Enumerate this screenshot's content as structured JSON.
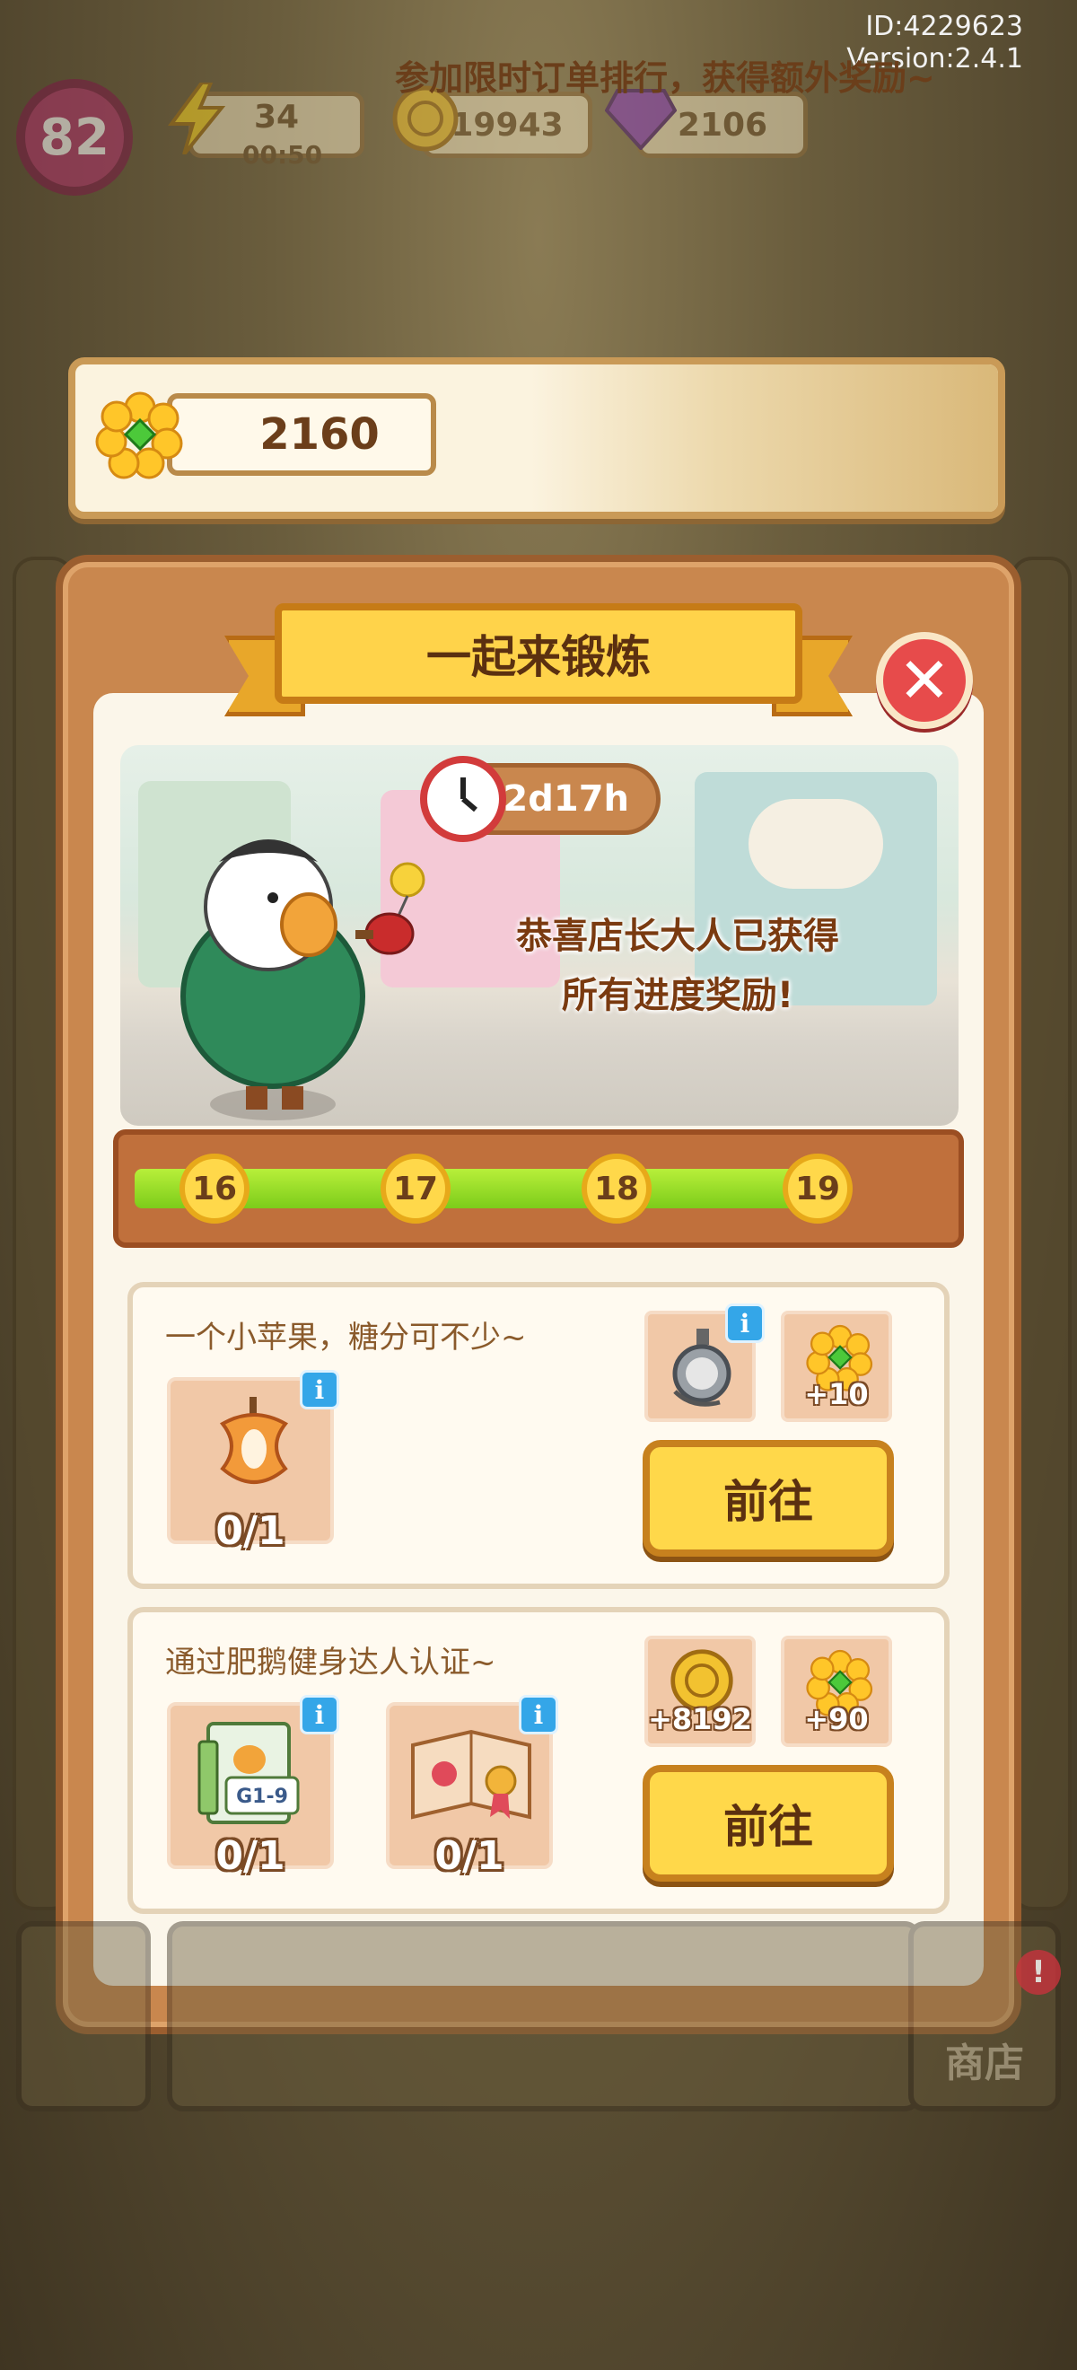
{
  "meta": {
    "id_text": "ID:4229623",
    "version_text": "Version:2.4.1"
  },
  "hud": {
    "level": "82",
    "energy": "34",
    "energy_timer": "00:50",
    "coins": "19943",
    "gems": "2106"
  },
  "event_banner": {
    "flower_count": "2160",
    "text": "参加限时订单排行，获得额外奖励~"
  },
  "panel": {
    "title": "一起来锻炼",
    "timer": "2d17h",
    "congrats_line1": "恭喜店长大人已获得",
    "congrats_line2": "所有进度奖励!",
    "progress_fraction": 1.0,
    "milestones": [
      "16",
      "17",
      "18",
      "19"
    ]
  },
  "tasks": [
    {
      "description": "一个小苹果，糖分可不少~",
      "requirements": [
        {
          "icon": "apple-core-icon",
          "count": "0/1"
        }
      ],
      "rewards": [
        {
          "icon": "stopwatch-icon",
          "amount": ""
        },
        {
          "icon": "flower-icon",
          "amount": "+10"
        }
      ],
      "button_label": "前往"
    },
    {
      "description": "通过肥鹅健身达人认证~",
      "requirements": [
        {
          "icon": "fitness-card-icon",
          "count": "0/1"
        },
        {
          "icon": "certificate-icon",
          "count": "0/1"
        }
      ],
      "rewards": [
        {
          "icon": "coin-icon",
          "amount": "+8192"
        },
        {
          "icon": "flower-icon",
          "amount": "+90"
        }
      ],
      "button_label": "前往"
    }
  ],
  "bottom_nav": {
    "shop_label": "商店",
    "shop_badge": "!"
  },
  "colors": {
    "accent_yellow": "#ffd84a",
    "panel_brown": "#c9874e",
    "progress_green": "#8fdc22",
    "close_red": "#e74b4b"
  }
}
